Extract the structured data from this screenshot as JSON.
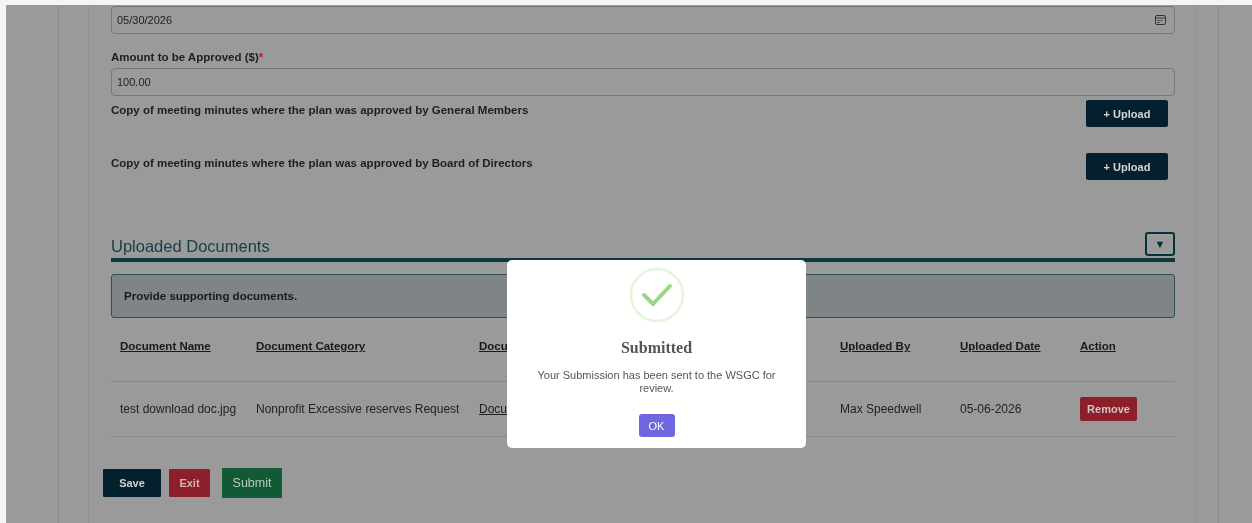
{
  "date_field": {
    "value": "05/30/2026"
  },
  "amount_field": {
    "label": "Amount to be Approved ($)",
    "required_mark": "*",
    "value": "100.00"
  },
  "uploads": [
    {
      "label": "Copy of meeting minutes where the plan was approved by General Members",
      "button": "+ Upload"
    },
    {
      "label": "Copy of meeting minutes where the plan was approved by Board of Directors",
      "button": "+ Upload"
    }
  ],
  "section": {
    "title": "Uploaded Documents",
    "toggle": "▼",
    "expanded": true
  },
  "banner": "Provide supporting documents.",
  "table": {
    "columns": [
      "Document Name",
      "Document Category",
      "Docu",
      "Uploaded By",
      "Uploaded Date",
      "Action"
    ],
    "rows": [
      {
        "cells": [
          "test download doc.jpg",
          "Nonprofit Excessive reserves Request",
          "Docu",
          "Max Speedwell",
          "05-06-2026"
        ],
        "action": "Remove"
      }
    ]
  },
  "buttons": [
    {
      "label": "Save",
      "kind": "save"
    },
    {
      "label": "Exit",
      "kind": "exit"
    },
    {
      "label": "Submit",
      "kind": "submit"
    }
  ],
  "dialog": {
    "title": "Submitted",
    "message": "Your Submission has been sent to the WSGC for review.",
    "button": "OK"
  }
}
